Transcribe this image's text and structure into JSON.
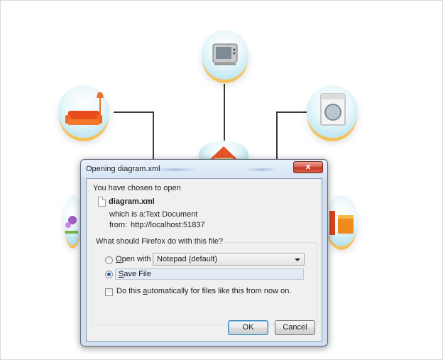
{
  "dialog": {
    "title": "Opening diagram.xml",
    "close_glyph": "x",
    "intro": "You have chosen to open",
    "file_name": "diagram.xml",
    "which_is_label": "which is a:",
    "which_is_value": "Text Document",
    "from_label": "from:",
    "from_value": "http://localhost:51837",
    "question": "What should Firefox do with this file?",
    "open_with_label_pre": "",
    "open_with_mnemonic": "O",
    "open_with_label_post": "pen with",
    "open_with_app": "Notepad (default)",
    "save_file_mnemonic": "S",
    "save_file_label_post": "ave File",
    "auto_label_pre": "Do this ",
    "auto_mnemonic": "a",
    "auto_label_post": "utomatically for files like this from now on.",
    "selected_option": "save-file",
    "ok_label": "OK",
    "cancel_label": "Cancel"
  },
  "diagram": {
    "nodes": [
      "tv-icon",
      "sofa-lamp-icon",
      "washing-machine-icon",
      "house-icon",
      "flower-icon",
      "paint-bucket-icon"
    ],
    "accent_ring_color": "#f4c25a",
    "bubble_color": "#bfe7f2"
  }
}
